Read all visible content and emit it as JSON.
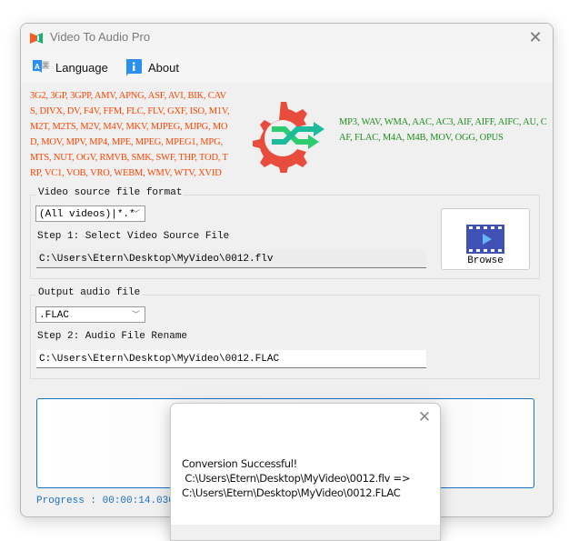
{
  "window": {
    "title": "Video To Audio Pro",
    "close_label": "✕"
  },
  "menu": {
    "items": [
      {
        "label": "Language",
        "icon": "language-icon"
      },
      {
        "label": "About",
        "icon": "info-icon"
      }
    ]
  },
  "formats": {
    "video": "3G2, 3GP, 3GPP, AMV, APNG, ASF, AVI, BIK, CAVS, DIVX, DV, F4V, FFM, FLC, FLV, GXF, ISO, M1V, M2T, M2TS, M2V, M4V, MKV, MJPEG, MJPG, MOD, MOV, MPV, MP4, MPE, MPEG, MPEG1, MPG, MTS, NUT, OGV, RMVB, SMK, SWF, THP, TOD, TRP, VC1, VOB, VRO, WEBM, WMV, WTV, XVID",
    "audio": "MP3, WAV, WMA, AAC, AC3, AIF, AIFF, AIFC, AU, CAF, FLAC, M4A, M4B, MOV, OGG, OPUS",
    "video_color": "#ff4500",
    "audio_color": "#1f8f1f"
  },
  "source": {
    "group_label": "Video source file format",
    "format_select": "(All videos)|*.*",
    "step_label": "Step 1: Select Video Source File",
    "path": "C:\\Users\\Etern\\Desktop\\MyVideo\\0012.flv",
    "browse_label": "Browse"
  },
  "output": {
    "group_label": "Output audio file",
    "format_select": ".FLAC",
    "step_label": "Step 2: Audio File Rename",
    "path": "C:\\Users\\Etern\\Desktop\\MyVideo\\0012.FLAC"
  },
  "progress": {
    "text": "Progress : 00:00:14.03000"
  },
  "dialog": {
    "message": "Conversion Successful!\n C:\\Users\\Etern\\Desktop\\MyVideo\\0012.flv =>\nC:\\Users\\Etern\\Desktop\\MyVideo\\0012.FLAC",
    "close_label": "✕"
  },
  "colors": {
    "accent": "#1a73c7",
    "logo_gear": "#e74c3c",
    "logo_arrow_teal": "#1abc9c",
    "logo_arrow_green": "#2ecc71"
  }
}
